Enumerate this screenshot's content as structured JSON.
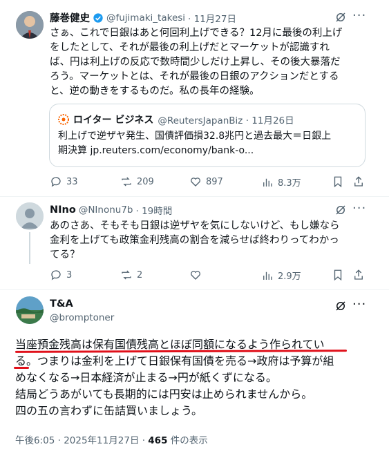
{
  "tweet1": {
    "name": "藤巻健史",
    "handle": "@fujimaki_takesi",
    "time": "· 11月27日",
    "text_lines": [
      "さぁ、これで日銀はあと何回利上げできる？12月に最後の利上げ",
      "をしたとして、それが最後の利上げだとマーケットが認識すれ",
      "ば、円は利上げの反応で数時間少しだけ上昇し、その後大暴落だ",
      "ろう。マーケットとは、それが最後の日銀のアクションだとする",
      "と、逆の動きをするものだ。私の長年の経験。"
    ],
    "quote": {
      "name": "ロイター ビジネス",
      "handle": "@ReutersJapanBiz · 11月26日",
      "line1": "利上げで逆ザヤ発生、国債評価損32.8兆円と過去最大＝日銀上",
      "line2": "期決算 jp.reuters.com/economy/bank-o..."
    },
    "stats": {
      "replies": "33",
      "reposts": "209",
      "likes": "897",
      "views": "8.3万"
    }
  },
  "tweet2": {
    "name": "NIno",
    "handle": "@NInonu7b",
    "time": "· 19時間",
    "text_lines": [
      "あのさあ、そもそも日銀は逆ザヤを気にしないけど、もし嫌なら",
      "金利を上げても政策金利残高の割合を減らせば終わりってわかっ",
      "てる？"
    ],
    "stats": {
      "replies": "3",
      "reposts": "2",
      "views": "2.9万"
    }
  },
  "tweet3": {
    "name": "T&A",
    "handle": "@bromptoner",
    "text_lines": [
      "当座預金残高は保有国債残高とほぼ同額になるよう作られてい",
      "る。つまりは金利を上げて日銀保有国債を売る→政府は予算が組",
      "めなくなる→日本経済が止まる→円が紙くずになる。",
      "結局どうあがいても長期的には円安は止められませんから。",
      "四の五の言わずに缶詰買いましょう。"
    ],
    "footer_time": "午後6:05 · 2025年11月27日 · ",
    "views_count": "465",
    "views_label": " 件の表示"
  },
  "colors": {
    "verified": "#1d9bf0",
    "underline": "#e0101a",
    "muted": "#536471"
  }
}
